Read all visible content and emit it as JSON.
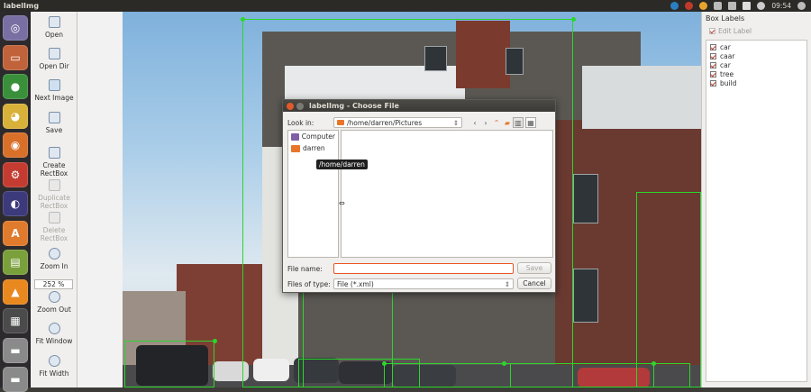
{
  "window": {
    "title": "labelImg",
    "time": "09:54"
  },
  "launcher": [
    {
      "name": "ubuntu-dash-icon",
      "glyph": "◎",
      "color": "#7a6fa3"
    },
    {
      "name": "files-icon",
      "glyph": "▭",
      "color": "#c0633a"
    },
    {
      "name": "chrome-icon",
      "glyph": "●",
      "color": "#3a8f3a"
    },
    {
      "name": "pidgin-icon",
      "glyph": "◕",
      "color": "#d8b13a"
    },
    {
      "name": "firefox-icon",
      "glyph": "◉",
      "color": "#d8702a"
    },
    {
      "name": "settings-icon",
      "glyph": "⚙",
      "color": "#c43c31"
    },
    {
      "name": "eclipse-icon",
      "glyph": "◐",
      "color": "#3c3a7a"
    },
    {
      "name": "software-center-icon",
      "glyph": "A",
      "color": "#e07a2c"
    },
    {
      "name": "text-editor-icon",
      "glyph": "▤",
      "color": "#7aa03c"
    },
    {
      "name": "vlc-icon",
      "glyph": "▲",
      "color": "#e8881e"
    },
    {
      "name": "workspace-icon",
      "glyph": "▦",
      "color": "#4b4b4b"
    },
    {
      "name": "drive-icon",
      "glyph": "▬",
      "color": "#8a8a8a"
    },
    {
      "name": "drive-2-icon",
      "glyph": "▬",
      "color": "#8a8a8a"
    }
  ],
  "tools": {
    "open": "Open",
    "open_dir": "Open Dir",
    "next_image": "Next Image",
    "save": "Save",
    "create_rectbox_1": "Create",
    "create_rectbox_2": "RectBox",
    "duplicate_1": "Duplicate",
    "duplicate_2": "RectBox",
    "delete_1": "Delete",
    "delete_2": "RectBox",
    "zoom_in": "Zoom In",
    "zoom_value": "252 %",
    "zoom_out": "Zoom Out",
    "fit_window": "Fit Window",
    "fit_width": "Fit Width"
  },
  "right_panel": {
    "header": "Box Labels",
    "edit_label": "Edit Label",
    "labels": [
      "car",
      "caar",
      "car",
      "tree",
      "build"
    ]
  },
  "dialog": {
    "title": "labelImg - Choose File",
    "look_in_label": "Look in:",
    "look_in_value": "/home/darren/Pictures",
    "places": [
      "Computer",
      "darren"
    ],
    "tooltip": "/home/darren",
    "file_name_label": "File name:",
    "file_name_value": "",
    "files_of_type_label": "Files of type:",
    "files_of_type_value": "File (*.xml)",
    "save_button": "Save",
    "cancel_button": "Cancel"
  },
  "colors": {
    "box": "#2cd62c",
    "accent": "#e95420"
  }
}
